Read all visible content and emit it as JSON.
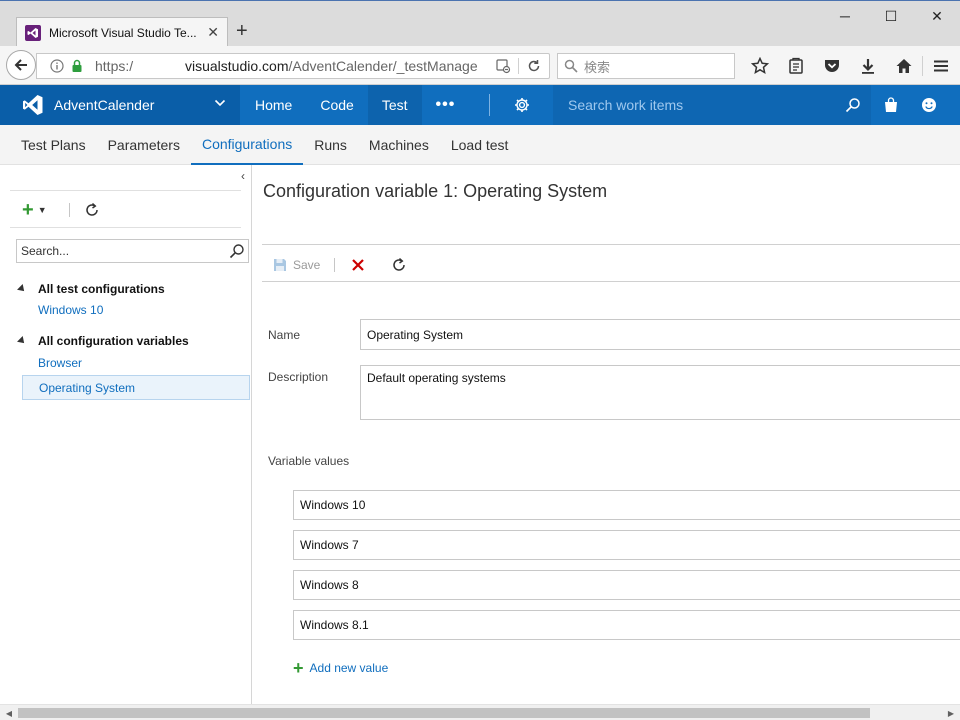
{
  "browser": {
    "tab_title": "Microsoft Visual Studio Te...",
    "new_tab": "+",
    "url_protocol": "https:/",
    "url_host": "visualstudio.com",
    "url_path": "/AdventCalender/_testManage",
    "search_placeholder": "検索",
    "window_controls": {
      "minimize": "─",
      "maximize": "☐",
      "close": "✕"
    }
  },
  "header": {
    "project_name": "AdventCalender",
    "hubs": [
      {
        "label": "Home"
      },
      {
        "label": "Code"
      },
      {
        "label": "Test"
      }
    ],
    "more_label": "•••",
    "search_placeholder": "Search work items"
  },
  "subtabs": [
    {
      "label": "Test Plans"
    },
    {
      "label": "Parameters"
    },
    {
      "label": "Configurations"
    },
    {
      "label": "Runs"
    },
    {
      "label": "Machines"
    },
    {
      "label": "Load test"
    }
  ],
  "left_panel": {
    "search_placeholder": "Search...",
    "groups": [
      {
        "label": "All test configurations",
        "items": [
          "Windows 10"
        ]
      },
      {
        "label": "All configuration variables",
        "items": [
          "Browser",
          "Operating System"
        ]
      }
    ]
  },
  "main": {
    "title": "Configuration variable 1: Operating System",
    "save_label": "Save",
    "name_label": "Name",
    "name_value": "Operating System",
    "description_label": "Description",
    "description_value": "Default operating systems",
    "variable_values_label": "Variable values",
    "values": [
      "Windows 10",
      "Windows 7",
      "Windows 8",
      "Windows 8.1"
    ],
    "add_value_label": "Add new value"
  },
  "colors": {
    "header_blue": "#106ebe",
    "accent_green": "#339933",
    "delete_red": "#cc0000"
  }
}
